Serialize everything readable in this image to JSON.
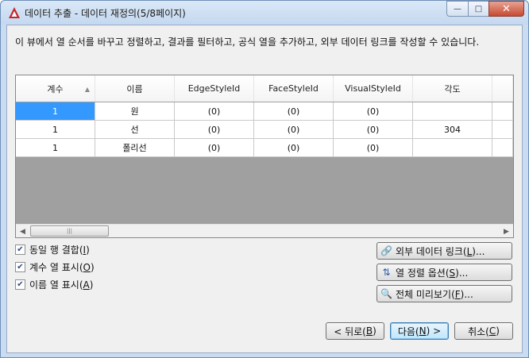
{
  "window": {
    "title": "데이터 추출 - 데이터 재정의(5/8페이지)",
    "controls": {
      "minimize": "—",
      "maximize": "□",
      "close": "✕"
    },
    "accent_color": "#c74a31"
  },
  "description": "이 뷰에서 열 순서를 바꾸고 정렬하고, 결과를 필터하고, 공식 열을 추가하고, 외부 데이터 링크를 작성할 수 있습니다.",
  "grid": {
    "columns": [
      "계수",
      "이름",
      "EdgeStyleId",
      "FaceStyleId",
      "VisualStyleId",
      "각도",
      ""
    ],
    "sort_indicator": "▲",
    "rows": [
      [
        "1",
        "원",
        "(0)",
        "(0)",
        "(0)",
        "",
        ""
      ],
      [
        "1",
        "선",
        "(0)",
        "(0)",
        "(0)",
        "304",
        ""
      ],
      [
        "1",
        "폴리선",
        "(0)",
        "(0)",
        "(0)",
        "",
        ""
      ]
    ],
    "scrollbar": {
      "left_arrow": "◀",
      "right_arrow": "▶",
      "grip": "|||"
    }
  },
  "options": [
    {
      "label": "동일 행 결합",
      "key": "I",
      "checked": true
    },
    {
      "label": "계수 열 표시",
      "key": "O",
      "checked": true
    },
    {
      "label": "이름 열 표시",
      "key": "A",
      "checked": true
    }
  ],
  "check_glyph": "✔",
  "side_buttons": [
    {
      "label": "외부 데이터 링크",
      "key": "L",
      "suffix": ")...",
      "icon": "link-icon",
      "glyph": "🔗"
    },
    {
      "label": "열 정렬 옵션",
      "key": "S",
      "suffix": ")...",
      "icon": "sort-az-icon",
      "glyph": "⇅"
    },
    {
      "label": "전체 미리보기",
      "key": "F",
      "suffix": ")...",
      "icon": "preview-icon",
      "glyph": "🔍"
    }
  ],
  "nav": {
    "back": {
      "prefix": "< 뒤로(",
      "key": "B",
      "suffix": ")"
    },
    "next": {
      "prefix": "다음(",
      "key": "N",
      "suffix": ") >"
    },
    "cancel": {
      "prefix": "취소(",
      "key": "C",
      "suffix": ")"
    }
  }
}
